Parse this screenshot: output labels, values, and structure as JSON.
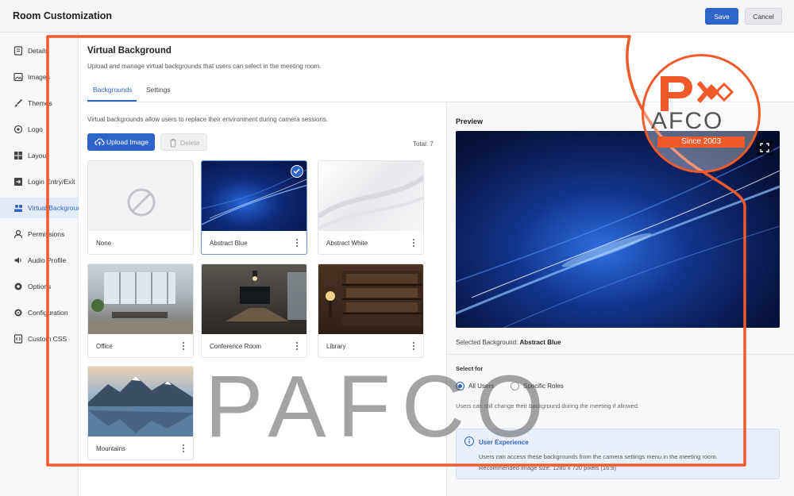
{
  "header": {
    "title": "Room Customization",
    "save_label": "Save",
    "cancel_label": "Cancel"
  },
  "sidebar": {
    "items": [
      {
        "label": "Details",
        "icon": "details-icon"
      },
      {
        "label": "Images",
        "icon": "image-icon"
      },
      {
        "label": "Themes",
        "icon": "brush-icon"
      },
      {
        "label": "Logo",
        "icon": "logo-icon"
      },
      {
        "label": "Layout",
        "icon": "layout-icon"
      },
      {
        "label": "Login Entry/Exit",
        "icon": "login-icon"
      },
      {
        "label": "Virtual Background",
        "icon": "virtual-background-icon"
      },
      {
        "label": "Permissions",
        "icon": "permissions-icon"
      },
      {
        "label": "Audio Profile",
        "icon": "audio-icon"
      },
      {
        "label": "Options",
        "icon": "gear-icon"
      },
      {
        "label": "Configuration",
        "icon": "cog-icon"
      },
      {
        "label": "Custom CSS",
        "icon": "css-icon"
      }
    ],
    "active_index": 6
  },
  "main": {
    "title": "Virtual Background",
    "subtitle": "Upload and manage virtual backgrounds that users can select in the meeting room.",
    "tabs": [
      {
        "label": "Backgrounds"
      },
      {
        "label": "Settings"
      }
    ],
    "description": "Virtual backgrounds allow users to replace their environment during camera sessions.",
    "upload_label": "Upload Image",
    "delete_label": "Delete",
    "total_label": "Total: 7",
    "cards": [
      {
        "name": "None"
      },
      {
        "name": "Abstract Blue",
        "selected": true
      },
      {
        "name": "Abstract White"
      },
      {
        "name": "Office"
      },
      {
        "name": "Conference Room"
      },
      {
        "name": "Library"
      },
      {
        "name": "Mountains"
      }
    ]
  },
  "preview": {
    "title": "Preview",
    "selected_label": "Selected Background:",
    "selected_value": "Abstract Blue",
    "select_for_label": "Select for",
    "radio_all": "All Users",
    "radio_specific": "Specific Roles",
    "change_note": "Users can still change their background during the meeting if allowed.",
    "info_title": "User Experience",
    "info_text": "Users can access these backgrounds from the camera settings menu in the meeting room.",
    "info_text2": "Recommended image size: 1280 x 720 pixels (16:9)"
  },
  "watermark": {
    "text": "PAFCO",
    "logo_word": "AFCO",
    "logo_since": "Since 2003"
  },
  "colors": {
    "accent": "#2f64c8",
    "watermark_orange": "#f05a2a"
  }
}
